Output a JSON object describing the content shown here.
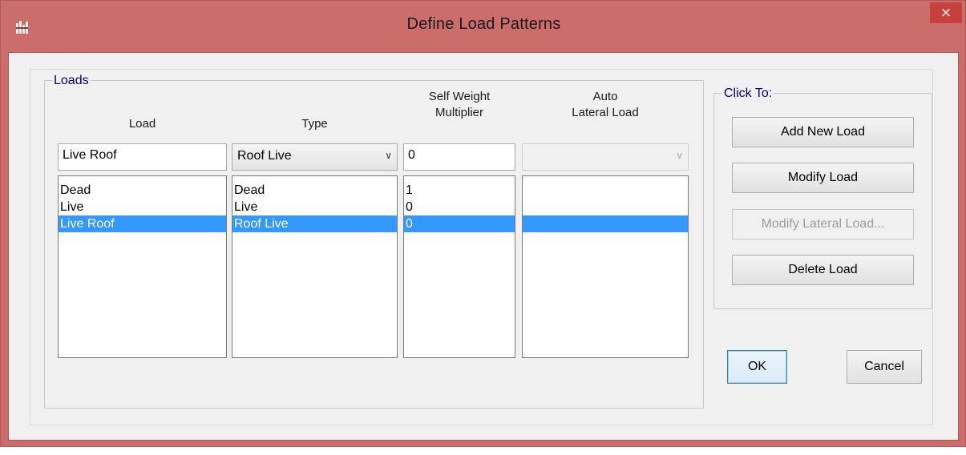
{
  "window": {
    "title": "Define Load Patterns",
    "close_label": "×",
    "accent_color": "#cb6d6b"
  },
  "loads_group": {
    "label": "Loads",
    "columns": {
      "load": "Load",
      "type": "Type",
      "self_weight_line1": "Self Weight",
      "self_weight_line2": "Multiplier",
      "auto_line1": "Auto",
      "auto_line2": "Lateral Load"
    },
    "inputs": {
      "load_name": "Live Roof",
      "type_selected": "Roof Live",
      "self_weight": "0",
      "auto_lateral": ""
    },
    "load_list": [
      "Dead",
      "Live",
      "Live Roof"
    ],
    "type_list": [
      "Dead",
      "Live",
      "Roof Live"
    ],
    "multiplier_list": [
      "1",
      "0",
      "0"
    ],
    "auto_list": [
      "",
      "",
      ""
    ],
    "selected_index": 2,
    "selection_color": "#3399ff"
  },
  "click_to_group": {
    "label": "Click To:",
    "add_new_load": "Add New Load",
    "modify_load": "Modify Load",
    "modify_lateral_load": "Modify Lateral Load...",
    "delete_load": "Delete Load"
  },
  "dialog_buttons": {
    "ok": "OK",
    "cancel": "Cancel"
  },
  "icons": {
    "app": "app-icon",
    "close": "close-icon",
    "dropdown": "chevron-down-icon"
  }
}
